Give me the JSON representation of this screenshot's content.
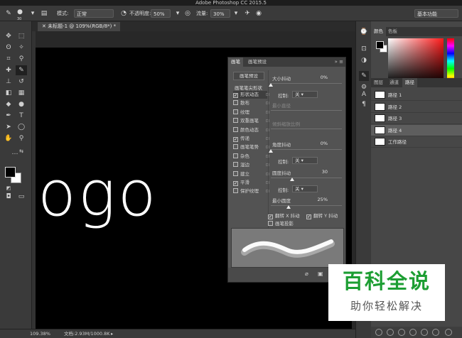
{
  "app": {
    "title": "Adobe Photoshop CC 2015.5"
  },
  "options_bar": {
    "brush_size": "30",
    "mode_label": "模式:",
    "mode_value": "正常",
    "opacity_label": "不透明度:",
    "opacity_value": "50%",
    "flow_label": "流量:",
    "flow_value": "30%",
    "workspace": "基本功能"
  },
  "document": {
    "tab_label": "未标题-1 @ 109%(RGB/8*) *",
    "canvas_text": "ogo",
    "zoom": "109.38%",
    "doc_info": "文档:2.93M/1000.8K"
  },
  "brush_panel": {
    "tabs": [
      "画笔",
      "画笔预设"
    ],
    "preset_button": "画笔预设",
    "tip_shape_label": "画笔笔尖形状",
    "items": [
      {
        "label": "形状动态",
        "checked": true
      },
      {
        "label": "散布",
        "checked": false
      },
      {
        "label": "纹理",
        "checked": false
      },
      {
        "label": "双重画笔",
        "checked": false
      },
      {
        "label": "颜色动态",
        "checked": false
      },
      {
        "label": "传递",
        "checked": true
      },
      {
        "label": "画笔笔势",
        "checked": false
      },
      {
        "label": "杂色",
        "checked": false
      },
      {
        "label": "湿边",
        "checked": false
      },
      {
        "label": "建立",
        "checked": false
      },
      {
        "label": "平滑",
        "checked": true
      },
      {
        "label": "保护纹理",
        "checked": false
      }
    ],
    "size_jitter_label": "大小抖动",
    "size_jitter_value": "0%",
    "control_label": "控制:",
    "control_off": "关",
    "min_diameter_label": "最小直径",
    "tilt_scale_label": "倾斜缩放比例",
    "angle_jitter_label": "角度抖动",
    "angle_jitter_value": "0%",
    "roundness_jitter_label": "圆度抖动",
    "roundness_jitter_value": "30",
    "min_roundness_label": "最小圆度",
    "min_roundness_value": "25%",
    "flip_x_label": "翻转 X 抖动",
    "flip_y_label": "翻转 Y 抖动",
    "brush_projection_label": "画笔投影"
  },
  "right_panels": {
    "color_tabs": [
      "颜色",
      "色板"
    ],
    "layer_tabs": [
      "图层",
      "通道",
      "路径"
    ],
    "paths": [
      "路径 1",
      "路径 2",
      "路径 3",
      "路径 4",
      "工作路径"
    ],
    "selected_path_index": 3
  },
  "watermark": {
    "title": "百科全说",
    "subtitle": "助你轻松解决",
    "color": "#1d9e33"
  },
  "colors": {
    "foreground": "#000000",
    "background": "#ffffff"
  }
}
